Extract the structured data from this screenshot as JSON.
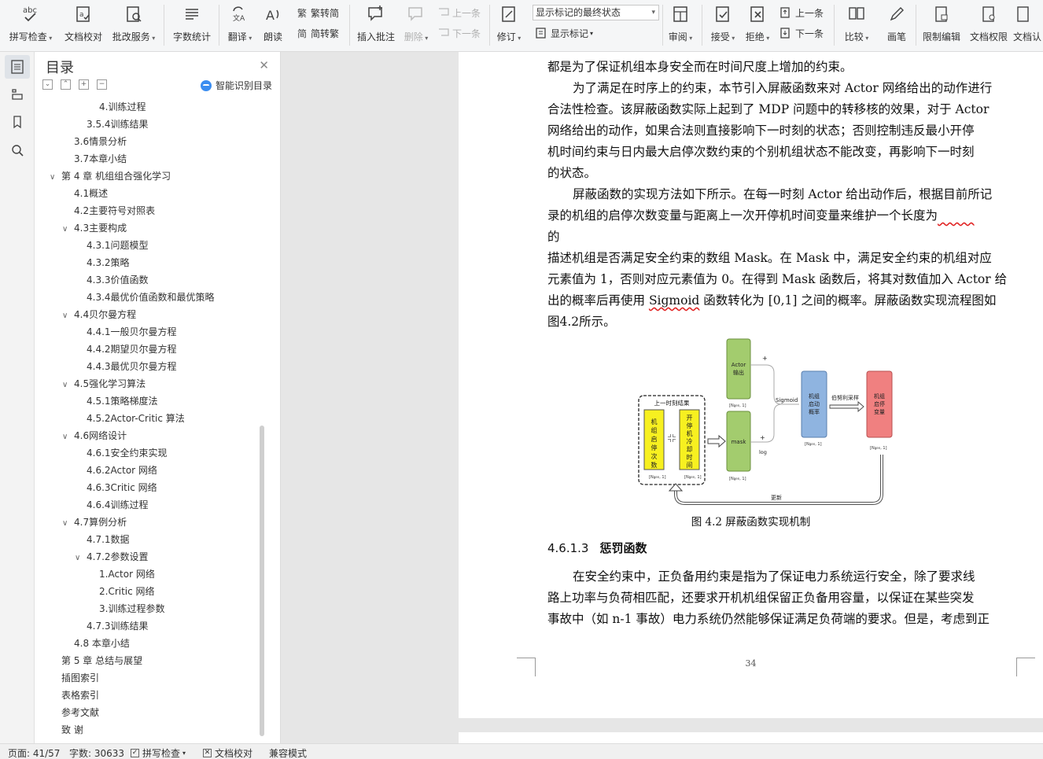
{
  "ribbon": {
    "spell_check": "拼写检查",
    "doc_proof": "文档校对",
    "batch_service": "批改服务",
    "word_count": "字数统计",
    "translate": "翻译",
    "read_aloud": "朗读",
    "to_traditional": "繁转简",
    "to_simplified": "简转繁",
    "insert_comment": "插入批注",
    "delete": "删除",
    "prev_comment": "上一条",
    "next_comment": "下一条",
    "revise": "修订",
    "markup_state": "显示标记的最终状态",
    "show_markup": "显示标记",
    "review": "审阅",
    "accept": "接受",
    "reject": "拒绝",
    "prev_change": "上一条",
    "next_change": "下一条",
    "compare": "比较",
    "pen": "画笔",
    "restrict_edit": "限制编辑",
    "doc_permission": "文档权限",
    "doc_auth": "文档认"
  },
  "toc": {
    "title": "目录",
    "smart_toc": "智能识别目录",
    "items": [
      {
        "text": "4.训练过程",
        "level": 3,
        "caret": ""
      },
      {
        "text": "3.5.4训练结果",
        "level": 2,
        "caret": ""
      },
      {
        "text": "3.6情景分析",
        "level": 1,
        "caret": ""
      },
      {
        "text": "3.7本章小结",
        "level": 1,
        "caret": ""
      },
      {
        "text": "第 4 章  机组组合强化学习",
        "level": 0,
        "caret": "v"
      },
      {
        "text": "4.1概述",
        "level": 1,
        "caret": ""
      },
      {
        "text": "4.2主要符号对照表",
        "level": 1,
        "caret": ""
      },
      {
        "text": "4.3主要构成",
        "level": 1,
        "caret": "v"
      },
      {
        "text": "4.3.1问题模型",
        "level": 2,
        "caret": ""
      },
      {
        "text": "4.3.2策略",
        "level": 2,
        "caret": ""
      },
      {
        "text": "4.3.3价值函数",
        "level": 2,
        "caret": ""
      },
      {
        "text": "4.3.4最优价值函数和最优策略",
        "level": 2,
        "caret": ""
      },
      {
        "text": "4.4贝尔曼方程",
        "level": 1,
        "caret": "v"
      },
      {
        "text": "4.4.1一般贝尔曼方程",
        "level": 2,
        "caret": ""
      },
      {
        "text": "4.4.2期望贝尔曼方程",
        "level": 2,
        "caret": ""
      },
      {
        "text": "4.4.3最优贝尔曼方程",
        "level": 2,
        "caret": ""
      },
      {
        "text": "4.5强化学习算法",
        "level": 1,
        "caret": "v"
      },
      {
        "text": "4.5.1策略梯度法",
        "level": 2,
        "caret": ""
      },
      {
        "text": "4.5.2Actor-Critic 算法",
        "level": 2,
        "caret": ""
      },
      {
        "text": "4.6网络设计",
        "level": 1,
        "caret": "v"
      },
      {
        "text": "4.6.1安全约束实现",
        "level": 2,
        "caret": ""
      },
      {
        "text": "4.6.2Actor 网络",
        "level": 2,
        "caret": ""
      },
      {
        "text": "4.6.3Critic 网络",
        "level": 2,
        "caret": ""
      },
      {
        "text": "4.6.4训练过程",
        "level": 2,
        "caret": ""
      },
      {
        "text": "4.7算例分析",
        "level": 1,
        "caret": "v"
      },
      {
        "text": "4.7.1数据",
        "level": 2,
        "caret": ""
      },
      {
        "text": "4.7.2参数设置",
        "level": 2,
        "caret": "v"
      },
      {
        "text": "1.Actor 网络",
        "level": 3,
        "caret": ""
      },
      {
        "text": "2.Critic 网络",
        "level": 3,
        "caret": ""
      },
      {
        "text": "3.训练过程参数",
        "level": 3,
        "caret": ""
      },
      {
        "text": "4.7.3训练结果",
        "level": 2,
        "caret": ""
      },
      {
        "text": "4.8  本章小结",
        "level": 1,
        "caret": ""
      },
      {
        "text": "第 5 章  总结与展望",
        "level": 0,
        "caret": ""
      },
      {
        "text": "插图索引",
        "level": 0,
        "caret": ""
      },
      {
        "text": "表格索引",
        "level": 0,
        "caret": ""
      },
      {
        "text": "参考文献",
        "level": 0,
        "caret": ""
      },
      {
        "text": "致  谢",
        "level": 0,
        "caret": ""
      }
    ]
  },
  "doc": {
    "line1": "都是为了保证机组本身安全而在时间尺度上增加的约束。",
    "p1": [
      "为了满足在时序上的约束，本节引入屏蔽函数来对  Actor 网络给出的动作进行",
      "合法性检查。该屏蔽函数实际上起到了  MDP 问题中的转移核的效果，对于  Actor",
      "网络给出的动作，如果合法则直接影响下一时刻的状态；否则控制违反最小开停",
      "机时间约束与日内最大启停次数约束的个别机组状态不能改变，再影响下一时刻",
      "的状态。"
    ],
    "p2_l1": "屏蔽函数的实现方法如下所示。在每一时刻  Actor 给出动作后，根据目前所记",
    "p2_l2a": "录的机组的启停次数变量与距离上一次开停机时间变量来维护一个长度为",
    "p2_l2b": "",
    "p2_l3": "的",
    "p2_l4": "描述机组是否满足安全约束的数组  Mask。在 Mask 中，满足安全约束的机组对应",
    "p2_l5": "元素值为  1，否则对应元素值为  0。在得到 Mask 函数后，将其对数值加入 Actor 给",
    "p2_l6a": "出的概率后再使用  ",
    "p2_l6b": "Sigmoid",
    "p2_l6c": " 函数转化为  [0,1] 之间的概率。屏蔽函数实现流程图如",
    "p2_l7": "图4.2所示。",
    "figure": {
      "actor_out": [
        "Actor",
        "输出"
      ],
      "last_state": "上一时刻结果",
      "start_count": [
        "机",
        "组",
        "启",
        "停",
        "次",
        "数"
      ],
      "cooldown": [
        "开",
        "停",
        "机",
        "冷",
        "却",
        "时",
        "间"
      ],
      "mask": "mask",
      "sigmoid": "Sigmoid",
      "plus": "+",
      "log": "log",
      "prob": [
        "机组",
        "启动",
        "概率"
      ],
      "bernoulli": "伯努利采样",
      "state_var": [
        "机组",
        "启停",
        "变量"
      ],
      "dim": "[N",
      "dim_sub": "gen",
      "dim_tail": ", 1]",
      "update": "更新"
    },
    "caption": "图 4.2    屏蔽函数实现机制",
    "heading_num": "4.6.1.3",
    "heading_text": "惩罚函数",
    "p3": [
      "在安全约束中，正负备用约束是指为了保证电力系统运行安全，除了要求线",
      "路上功率与负荷相匹配，还要求开机机组保留正负备用容量，以保证在某些突发",
      "事故中（如 n-1 事故）电力系统仍然能够保证满足负荷端的要求。但是，考虑到正"
    ],
    "page_number": "34"
  },
  "status": {
    "page": "页面: 41/57",
    "words": "字数: 30633",
    "spell": "拼写检查",
    "proof": "文档校对",
    "compat": "兼容模式"
  },
  "colors": {
    "green": "#a3cc6e",
    "yellow": "#f7f020",
    "blue": "#8fb4e0",
    "red": "#f08080",
    "accent": "#3b8df0"
  }
}
